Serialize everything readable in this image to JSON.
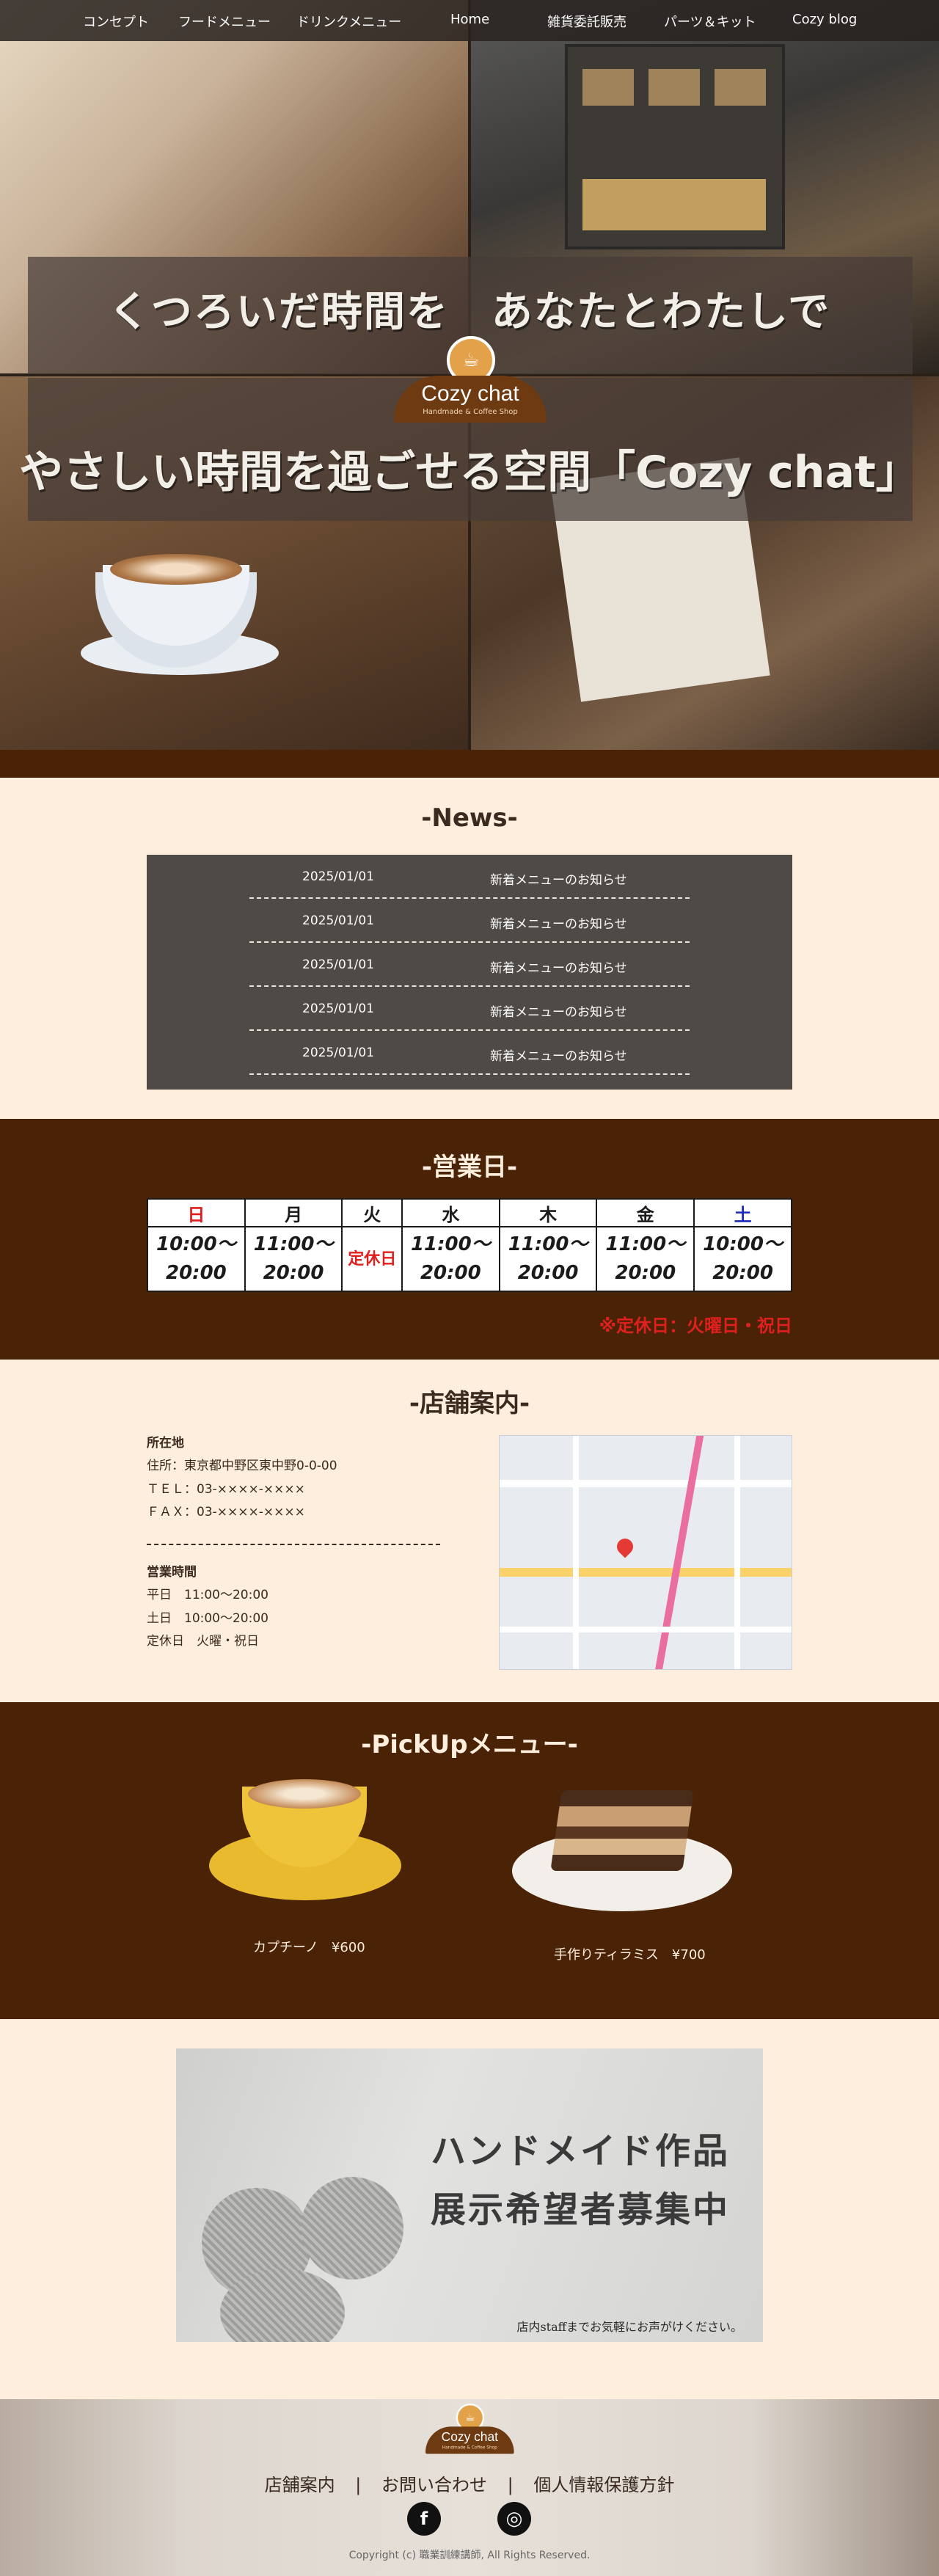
{
  "nav": {
    "items": [
      "コンセプト",
      "フードメニュー",
      "ドリンクメニュー",
      "Home",
      "雑貨委託販売",
      "パーツ＆キット",
      "Cozy blog"
    ]
  },
  "hero": {
    "line1": "くつろいだ時間を　あなたとわたしで",
    "line2": "やさしい時間を過ごせる空間「Cozy chat」"
  },
  "logo": {
    "name": "Cozy chat",
    "sub": "Handmade & Coffee Shop"
  },
  "news": {
    "title": "-News-",
    "items": [
      {
        "date": "2025/01/01",
        "text": "新着メニューのお知らせ"
      },
      {
        "date": "2025/01/01",
        "text": "新着メニューのお知らせ"
      },
      {
        "date": "2025/01/01",
        "text": "新着メニューのお知らせ"
      },
      {
        "date": "2025/01/01",
        "text": "新着メニューのお知らせ"
      },
      {
        "date": "2025/01/01",
        "text": "新着メニューのお知らせ"
      }
    ]
  },
  "days": {
    "title": "-営業日-",
    "headers": [
      "日",
      "月",
      "火",
      "水",
      "木",
      "金",
      "土"
    ],
    "hours": {
      "sun": "10:00～ 20:00",
      "mon": "11:00～ 20:00",
      "tue": "定休日",
      "wed": "11:00～ 20:00",
      "thu": "11:00～ 20:00",
      "fri": "11:00～ 20:00",
      "sat": "10:00～ 20:00"
    },
    "note": "※定休日：火曜日・祝日",
    "colors": {
      "sun": "#e0201e",
      "sat": "#1a2ab8",
      "closed": "#e0201e"
    }
  },
  "store": {
    "title": "-店舗案内-",
    "location_heading": "所在地",
    "address": "住所：東京都中野区東中野0-0-00",
    "tel": "ＴＥＬ：03-××××-××××",
    "fax": "ＦＡＸ：03-××××-××××",
    "hours_heading": "営業時間",
    "weekday": "平日　11:00～20:00",
    "weekend": "土日　10:00～20:00",
    "closed": "定休日　火曜・祝日"
  },
  "pickup": {
    "title": "-PickUpメニュー-",
    "items": [
      {
        "label": "カプチーノ　¥600"
      },
      {
        "label": "手作りティラミス　¥700"
      }
    ]
  },
  "banner": {
    "line1": "ハンドメイド作品",
    "line2": "展示希望者募集中",
    "sub": "店内staffまでお気軽にお声がけください。"
  },
  "footer": {
    "links": [
      "店舗案内",
      "お問い合わせ",
      "個人情報保護方針"
    ],
    "separator": "|",
    "copyright": "Copyright (c) 職業訓練講師, All Rights Reserved.",
    "sns": [
      {
        "icon": "facebook-icon",
        "glyph": "f"
      },
      {
        "icon": "instagram-icon",
        "glyph": "◎"
      }
    ]
  }
}
